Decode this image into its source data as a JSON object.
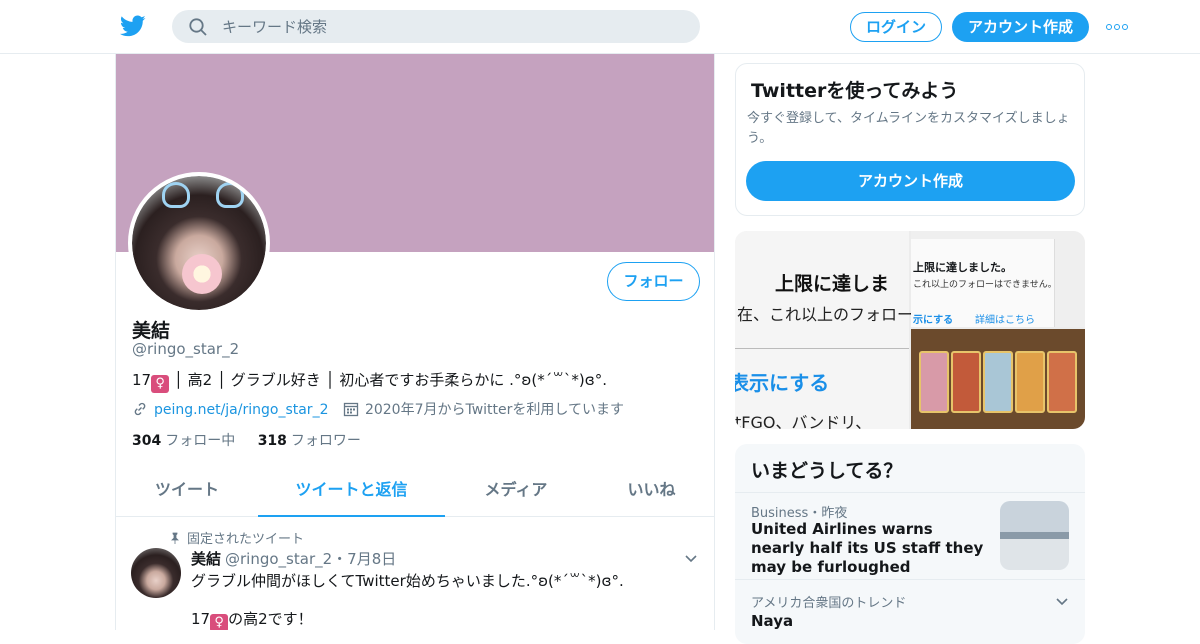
{
  "header": {
    "logo_icon": "twitter-bird-icon",
    "search_placeholder": "キーワード検索",
    "login_label": "ログイン",
    "signup_label": "アカウント作成",
    "more_icon": "more-dots-icon",
    "brand_color": "#1da1f2"
  },
  "profile": {
    "banner_color": "#c5a2bf",
    "name": "美結",
    "handle": "@ringo_star_2",
    "follow_label": "フォロー",
    "bio_pre": "17",
    "bio_post": "│ 高2 │ グラブル好き │ 初心者ですお手柔らかに .°ʚ(*´꒳`*)ɞ°.",
    "venus": "♀",
    "link": "peing.net/ja/ringo_star_2",
    "joined": "2020年7月からTwitterを利用しています",
    "following_count": "304",
    "following_label": "フォロー中",
    "followers_count": "318",
    "followers_label": "フォロワー"
  },
  "tabs": [
    {
      "label": "ツイート",
      "active": false
    },
    {
      "label": "ツイートと返信",
      "active": true
    },
    {
      "label": "メディア",
      "active": false
    },
    {
      "label": "いいね",
      "active": false
    }
  ],
  "pinned_tweet": {
    "pinned_label": "固定されたツイート",
    "name": "美結",
    "handle": "@ringo_star_2",
    "date": "・7月8日",
    "text1": "グラブル仲間がほしくてTwitter始めちゃいました.°ʚ(*´꒳`*)ɞ°.",
    "text2_pre": "17",
    "text2_post": "の高2です！"
  },
  "signup_card": {
    "title": "Twitterを使ってみよう",
    "description": "今すぐ登録して、タイムラインをカスタマイズしましょう。",
    "button_label": "アカウント作成"
  },
  "media_preview": {
    "left_title": "上限に達しま",
    "left_sub": "在、これ以上のフォロー",
    "left_link": "表示にする",
    "left_bottom": "tFGO、バンドリ、",
    "dialog_title": "上限に達しました。",
    "dialog_sub": "これ以上のフォローはできません。",
    "dialog_btn1": "示にする",
    "dialog_btn2": "詳細はこちら"
  },
  "trends": {
    "title": "いまどうしてる？",
    "items": [
      {
        "category": "Business・昨夜",
        "headline": "United Airlines warns nearly half its US staff they may be furloughed"
      },
      {
        "category": "アメリカ合衆国のトレンド",
        "name": "Naya"
      }
    ]
  }
}
